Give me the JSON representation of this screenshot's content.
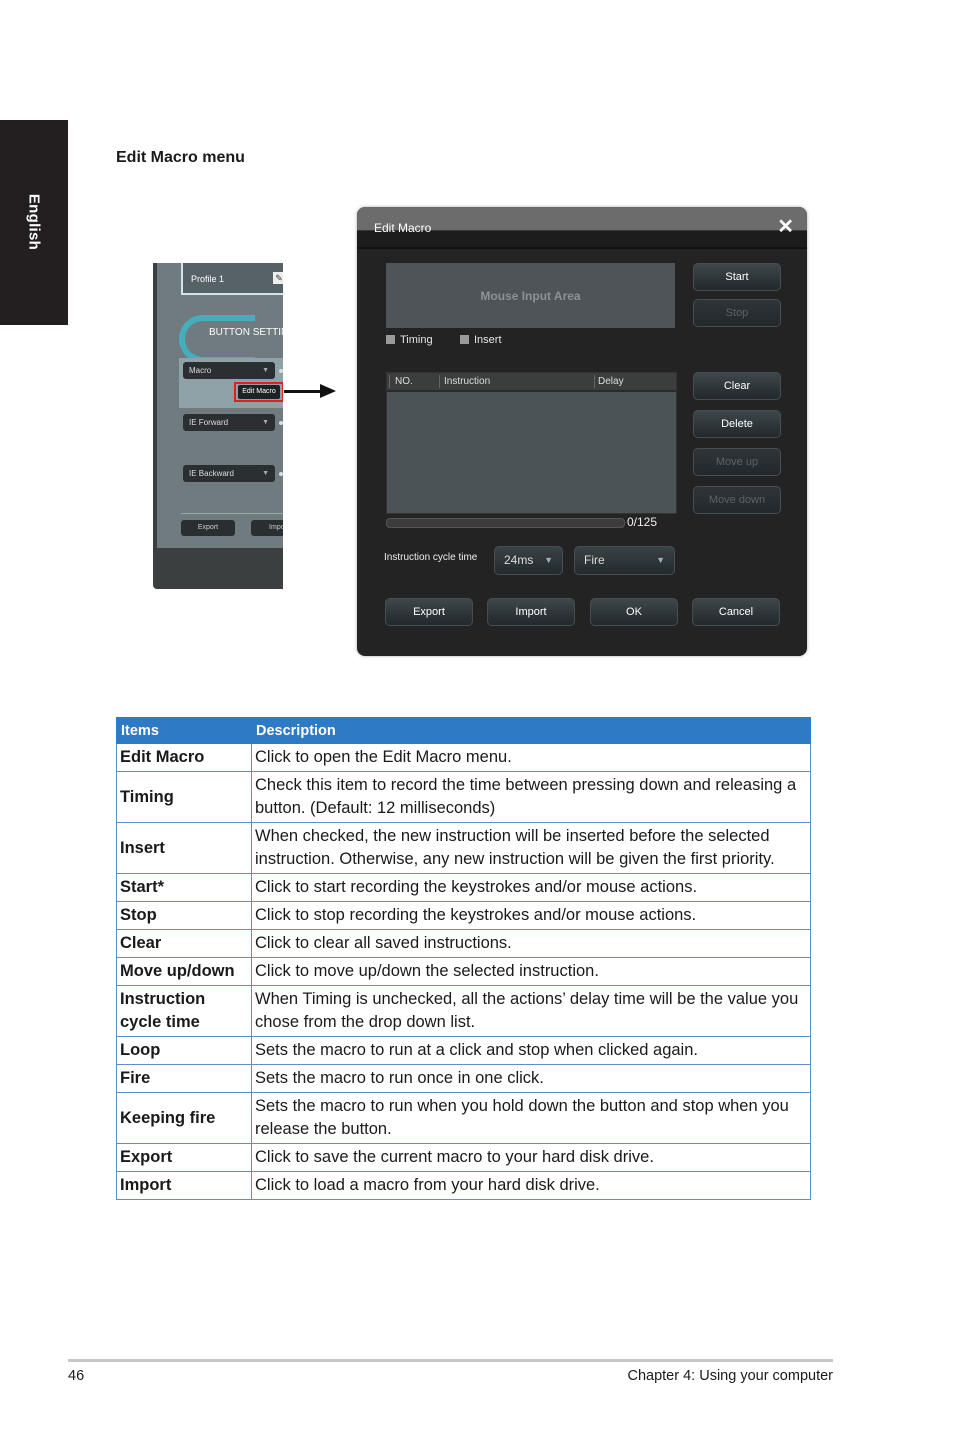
{
  "side_tab": {
    "label": "English"
  },
  "section_title": "Edit Macro menu",
  "left_panel": {
    "profile_label": "Profile 1",
    "profile_icon": "pencil-icon",
    "header": "BUTTON SETTIN",
    "dropdowns": [
      "Macro",
      "IE Forward",
      "IE Backward"
    ],
    "edit_macro_button": "Edit Macro",
    "highlight_color": "#e02020",
    "bottom_buttons": [
      "Export",
      "Impor"
    ]
  },
  "dialog": {
    "title": "Edit Macro",
    "close_icon": "close-icon",
    "mouse_input_area": "Mouse Input Area",
    "checkboxes": [
      {
        "label": "Timing",
        "checked": false
      },
      {
        "label": "Insert",
        "checked": false
      }
    ],
    "record_buttons": [
      {
        "label": "Start",
        "enabled": true
      },
      {
        "label": "Stop",
        "enabled": false
      }
    ],
    "list_columns": [
      "NO.",
      "Instruction",
      "Delay"
    ],
    "edit_buttons": [
      {
        "label": "Clear",
        "enabled": true
      },
      {
        "label": "Delete",
        "enabled": true
      },
      {
        "label": "Move up",
        "enabled": false
      },
      {
        "label": "Move down",
        "enabled": false
      }
    ],
    "progress": {
      "current": 0,
      "max": 125,
      "text": "0/125"
    },
    "cycle_time_label": "Instruction cycle time",
    "cycle_time_value": "24ms",
    "mode_value": "Fire",
    "footer_buttons": [
      "Export",
      "Import",
      "OK",
      "Cancel"
    ]
  },
  "table": {
    "header_color": "#2f7ac5",
    "columns": [
      "Items",
      "Description"
    ],
    "rows": [
      {
        "item": "Edit Macro",
        "description": "Click to open the Edit Macro menu."
      },
      {
        "item": "Timing",
        "description": "Check this item to record the time between pressing down and releasing a button. (Default: 12 milliseconds)"
      },
      {
        "item": "Insert",
        "description": "When checked, the new instruction will be inserted before the selected instruction. Otherwise, any new instruction will be given the first priority."
      },
      {
        "item": "Start*",
        "description": "Click to start recording the keystrokes and/or mouse actions."
      },
      {
        "item": "Stop",
        "description": "Click to stop recording the keystrokes and/or mouse actions."
      },
      {
        "item": "Clear",
        "description": "Click to clear all saved instructions."
      },
      {
        "item": "Move up/down",
        "description": "Click to move up/down the selected instruction."
      },
      {
        "item": "Instruction cycle time",
        "description": "When Timing is unchecked, all the actions’ delay time will be the value you chose from the drop down list."
      },
      {
        "item": "Loop",
        "description": "Sets the macro to run at a click and stop when clicked again."
      },
      {
        "item": "Fire",
        "description": "Sets the macro to run once in one click."
      },
      {
        "item": "Keeping fire",
        "description": "Sets the macro to run when you hold down the button and stop when you release the button."
      },
      {
        "item": "Export",
        "description": "Click to save the current macro to your hard disk drive."
      },
      {
        "item": "Import",
        "description": "Click to load a macro from your hard disk drive."
      }
    ]
  },
  "footer": {
    "page_number": "46",
    "chapter": "Chapter 4: Using your computer"
  }
}
